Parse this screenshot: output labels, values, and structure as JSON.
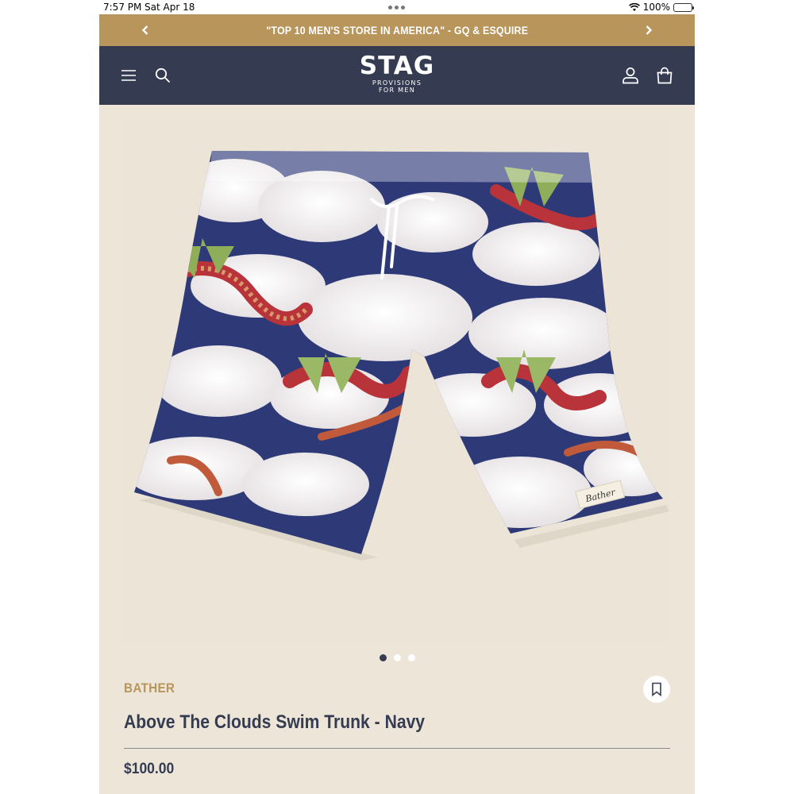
{
  "status_bar": {
    "time": "7:57 PM",
    "date": "Sat Apr 18",
    "battery": "100%"
  },
  "promo": {
    "message": "\"TOP 10 MEN'S STORE IN AMERICA\" - GQ & ESQUIRE"
  },
  "header": {
    "logo_main": "STAG",
    "logo_sub_1": "PROVISIONS",
    "logo_sub_2": "FOR MEN"
  },
  "gallery": {
    "image_count": 3,
    "active_index": 0,
    "patch_label": "Bather"
  },
  "product": {
    "brand": "BATHER",
    "title": "Above The Clouds Swim Trunk - Navy",
    "price": "$100.00"
  },
  "colors": {
    "promo_bar": "#b8955b",
    "header": "#353c52",
    "background": "#ede6d8",
    "brand_text": "#b8955b",
    "navy": "#2e3a78"
  },
  "icons": [
    "chevron-left-icon",
    "chevron-right-icon",
    "menu-icon",
    "search-icon",
    "account-icon",
    "bag-icon",
    "bookmark-icon",
    "wifi-icon",
    "battery-icon"
  ]
}
